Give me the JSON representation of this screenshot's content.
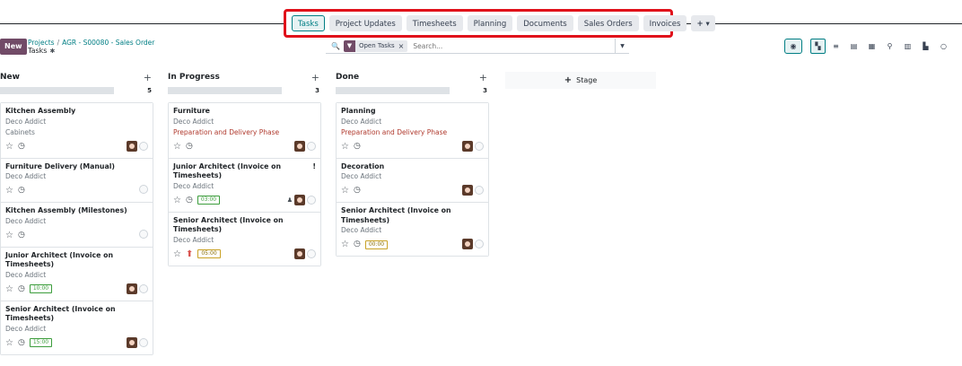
{
  "tabs": [
    {
      "label": "Tasks",
      "active": true
    },
    {
      "label": "Project Updates"
    },
    {
      "label": "Timesheets"
    },
    {
      "label": "Planning"
    },
    {
      "label": "Documents"
    },
    {
      "label": "Sales Orders"
    },
    {
      "label": "Invoices"
    }
  ],
  "tabs_more": "+ ▾",
  "control": {
    "new_label": "New",
    "breadcrumb_root": "Projects",
    "breadcrumb_sep": "/",
    "breadcrumb_current": "AGR - S00080 - Sales Order",
    "title": "Tasks"
  },
  "search": {
    "facet_label": "Open Tasks",
    "placeholder": "Search..."
  },
  "add_stage_label": "Stage",
  "columns": [
    {
      "name": "New",
      "count": "5",
      "cards": [
        {
          "title": "Kitchen Assembly",
          "customer": "Deco Addict",
          "tag": "Cabinets",
          "tag_style": "grey"
        },
        {
          "title": "Furniture Delivery (Manual)",
          "customer": "Deco Addict"
        },
        {
          "title": "Kitchen Assembly (Milestones)",
          "customer": "Deco Addict"
        },
        {
          "title": "Junior Architect (Invoice on Timesheets)",
          "customer": "Deco Addict",
          "time": "10:00"
        },
        {
          "title": "Senior Architect (Invoice on Timesheets)",
          "customer": "Deco Addict",
          "time": "15:00"
        }
      ]
    },
    {
      "name": "In Progress",
      "count": "3",
      "cards": [
        {
          "title": "Furniture",
          "customer": "Deco Addict",
          "tag": "Preparation and Delivery Phase"
        },
        {
          "title": "Junior Architect (Invoice on Timesheets)",
          "customer": "Deco Addict",
          "time": "03:00",
          "priority_mark": "!"
        },
        {
          "title": "Senior Architect (Invoice on Timesheets)",
          "customer": "Deco Addict",
          "time": "05:00"
        }
      ]
    },
    {
      "name": "Done",
      "count": "3",
      "cards": [
        {
          "title": "Planning",
          "customer": "Deco Addict",
          "tag": "Preparation and Delivery Phase"
        },
        {
          "title": "Decoration",
          "customer": "Deco Addict"
        },
        {
          "title": "Senior Architect (Invoice on Timesheets)",
          "customer": "Deco Addict",
          "time": "00:00"
        }
      ]
    }
  ]
}
